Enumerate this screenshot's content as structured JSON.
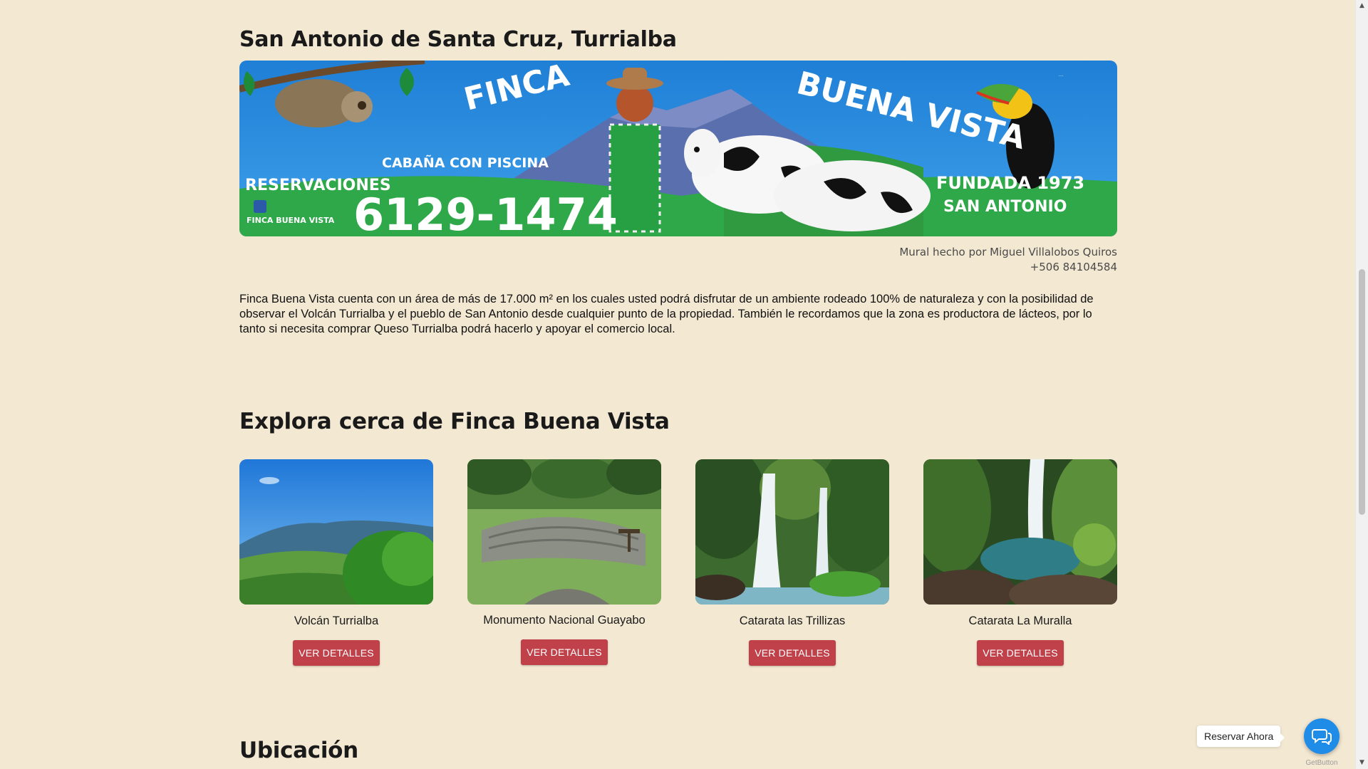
{
  "location": {
    "title": "San Antonio de Santa Cruz, Turrialba",
    "mural": {
      "label_finca": "FINCA",
      "label_buena_vista": "BUENA VISTA",
      "label_cabana": "CABAÑA CON PISCINA",
      "label_reservaciones": "RESERVACIONES",
      "phone": "6129-1474",
      "facebook": "FINCA BUENA VISTA",
      "fundada": "FUNDADA 1973",
      "place": "SAN ANTONIO"
    },
    "credit_line1": "Mural hecho por Miguel Villalobos Quiros",
    "credit_line2": "+506 84104584",
    "description": "Finca Buena Vista cuenta con un área de más de 17.000 m² en los cuales usted podrá disfrutar de un ambiente rodeado 100% de naturaleza y con la posibilidad de observar el Volcán Turrialba y el pueblo de San Antonio desde cualquier punto de la propiedad. También le recordamos que la zona es productora de lácteos, por lo tanto si necesita comprar Queso Turrialba podrá hacerlo y apoyar el comercio local."
  },
  "explore": {
    "title": "Explora cerca de Finca Buena Vista",
    "cards": [
      {
        "name": "Volcán Turrialba",
        "button": "VER DETALLES"
      },
      {
        "name": "Monumento Nacional Guayabo",
        "button": "VER DETALLES"
      },
      {
        "name": "Catarata las Trillizas",
        "button": "VER DETALLES"
      },
      {
        "name": "Catarata La Muralla",
        "button": "VER DETALLES"
      }
    ]
  },
  "ubicacion": {
    "title": "Ubicación"
  },
  "chat_widget": {
    "tooltip": "Reservar Ahora",
    "brand": "GetButton",
    "icon": "chat-bubble-icon"
  },
  "colors": {
    "background": "#f3e8d2",
    "button": "#c0414a",
    "chat_button": "#1f8ce8"
  }
}
